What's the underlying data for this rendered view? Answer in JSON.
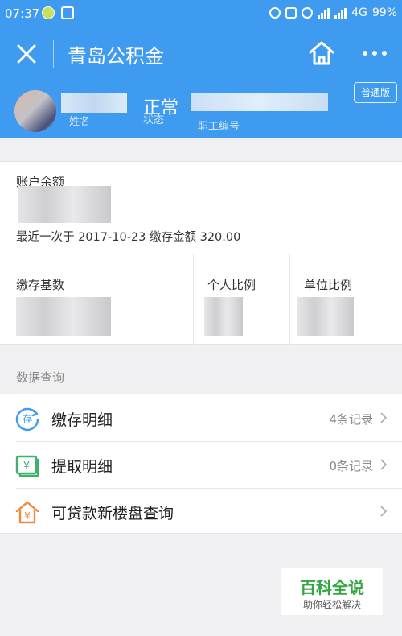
{
  "status_bar": {
    "time": "07:37",
    "network": "4G",
    "battery": "99%"
  },
  "header": {
    "title": "青岛公积金",
    "version_label": "普通版"
  },
  "profile": {
    "name_label": "姓名",
    "status_value": "正常",
    "status_label": "状态",
    "id_label": "职工编号"
  },
  "account": {
    "balance_label": "账户余额",
    "last_payment": "最近一次于 2017-10-23 缴存金额 320.00",
    "columns": [
      {
        "label": "缴存基数"
      },
      {
        "label": "个人比例"
      },
      {
        "label": "单位比例"
      }
    ]
  },
  "query": {
    "section_title": "数据查询",
    "items": [
      {
        "label": "缴存明细",
        "count": "4条记录"
      },
      {
        "label": "提取明细",
        "count": "0条记录"
      },
      {
        "label": "可贷款新楼盘查询",
        "count": ""
      }
    ]
  },
  "brand": {
    "title": "百科全说",
    "subtitle": "助你轻松解决"
  },
  "colors": {
    "primary": "#3e9bef",
    "deposit_icon": "#3e9bef",
    "withdraw_icon": "#3bb36a",
    "house_icon": "#f08a3c",
    "brand_green": "#33a642"
  },
  "icons": [
    "close-icon",
    "home-icon",
    "more-icon",
    "deposit-icon",
    "withdraw-icon",
    "house-icon",
    "chevron-right-icon"
  ]
}
